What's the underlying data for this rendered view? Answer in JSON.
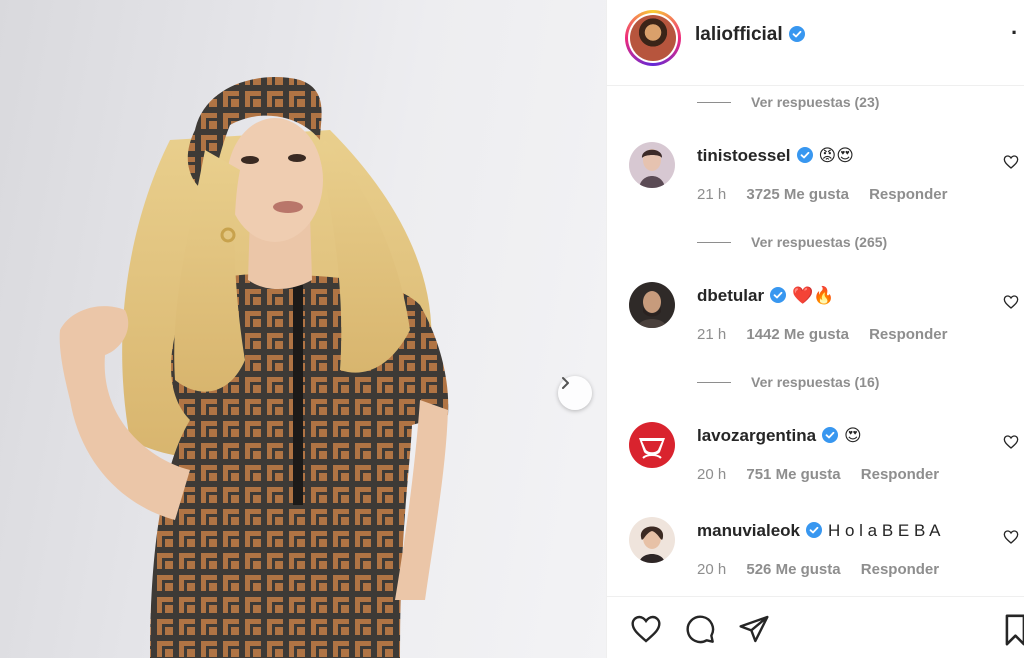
{
  "post": {
    "username": "laliofficial",
    "verified": true,
    "more_label": "·"
  },
  "comments": [
    {
      "type": "replies",
      "label": "Ver respuestas (23)"
    },
    {
      "type": "comment",
      "username": "tinistoessel",
      "text": "😡😍",
      "time": "21 h",
      "likes": "3725 Me gusta",
      "reply_label": "Responder",
      "avatar_color": "#c9b8c4"
    },
    {
      "type": "replies",
      "label": "Ver respuestas (265)"
    },
    {
      "type": "comment",
      "username": "dbetular",
      "text": "❤️🔥",
      "time": "21 h",
      "likes": "1442 Me gusta",
      "reply_label": "Responder",
      "avatar_color": "#3a3230"
    },
    {
      "type": "replies",
      "label": "Ver respuestas (16)"
    },
    {
      "type": "comment",
      "username": "lavozargentina",
      "text": "😍",
      "time": "20 h",
      "likes": "751 Me gusta",
      "reply_label": "Responder",
      "avatar_color": "#d9232e"
    },
    {
      "type": "comment",
      "username": "manuvialeok",
      "text": "H o l a B E B A",
      "time": "20 h",
      "likes": "526 Me gusta",
      "reply_label": "Responder",
      "avatar_color": "#e9d8cc"
    }
  ],
  "icons": {
    "verified": "verified-badge-icon",
    "like": "heart-icon",
    "comment": "comment-icon",
    "share": "share-icon",
    "save": "bookmark-icon",
    "next": "chevron-right-icon"
  },
  "colors": {
    "verified": "#3897f0",
    "text": "#262626",
    "muted": "#8e8e8e"
  }
}
